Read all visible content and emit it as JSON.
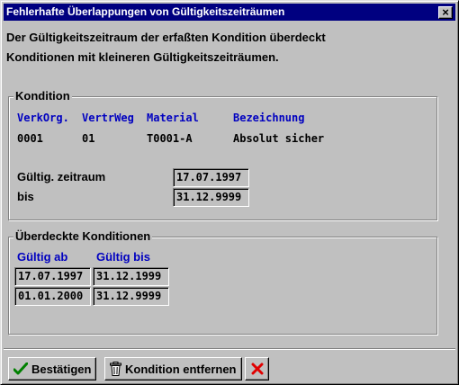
{
  "window": {
    "title": "Fehlerhafte Überlappungen von Gültigkeitszeiträumen",
    "close_symbol": "×"
  },
  "message": {
    "line1": "Der Gültigkeitszeitraum der erfaßten Kondition überdeckt",
    "line2": "Konditionen mit kleineren Gültigkeitszeiträumen."
  },
  "kondition": {
    "group_label": "Kondition",
    "headers": {
      "verkorg": "VerkOrg.",
      "vertrweg": "VertrWeg",
      "material": "Material",
      "bezeichnung": "Bezeichnung"
    },
    "row": {
      "verkorg": "0001",
      "vertrweg": "01",
      "material": "T0001-A",
      "bezeichnung": "Absolut sicher"
    },
    "gueltig_label": "Gültig. zeitraum",
    "gueltig_value": "17.07.1997",
    "bis_label": "bis",
    "bis_value": "31.12.9999"
  },
  "ueberdeckte": {
    "group_label": "Überdeckte Konditionen",
    "col_gueltig_ab": "Gültig ab",
    "col_gueltig_bis": "Gültig bis",
    "rows": [
      {
        "ab": "17.07.1997",
        "bis": "31.12.1999"
      },
      {
        "ab": "01.01.2000",
        "bis": "31.12.9999"
      }
    ]
  },
  "buttons": {
    "confirm": "Bestätigen",
    "remove": "Kondition entfernen"
  },
  "icons": {
    "confirm": "checkmark-icon",
    "remove": "trash-icon",
    "cancel": "red-x-icon",
    "close": "close-icon"
  },
  "colors": {
    "title_bar": "#000080",
    "column_header": "#0000c0",
    "checkmark": "#008000",
    "cancel_x": "#e00000"
  }
}
